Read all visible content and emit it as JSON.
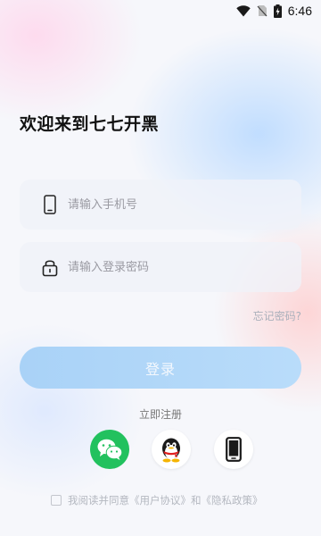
{
  "status_bar": {
    "time": "6:46"
  },
  "login": {
    "title": "欢迎来到七七开黑",
    "phone_placeholder": "请输入手机号",
    "password_placeholder": "请输入登录密码",
    "forgot_password": "忘记密码?",
    "login_button": "登录",
    "register": "立即注册"
  },
  "social": [
    {
      "name": "wechat",
      "icon": "wechat-icon",
      "color": "#22C15E"
    },
    {
      "name": "qq",
      "icon": "qq-penguin-icon",
      "color": "#FFFFFF"
    },
    {
      "name": "phone",
      "icon": "phone-icon",
      "color": "#FFFFFF"
    }
  ],
  "agreement": {
    "prefix": "我阅读并同意",
    "user_agreement": "《用户协议》",
    "conjunction": "和",
    "privacy_policy": "《隐私政策》"
  },
  "colors": {
    "accent": "#A9D2F7",
    "wechat_green": "#22C15E",
    "text_dark": "#111111",
    "placeholder": "#9A9AA2"
  }
}
